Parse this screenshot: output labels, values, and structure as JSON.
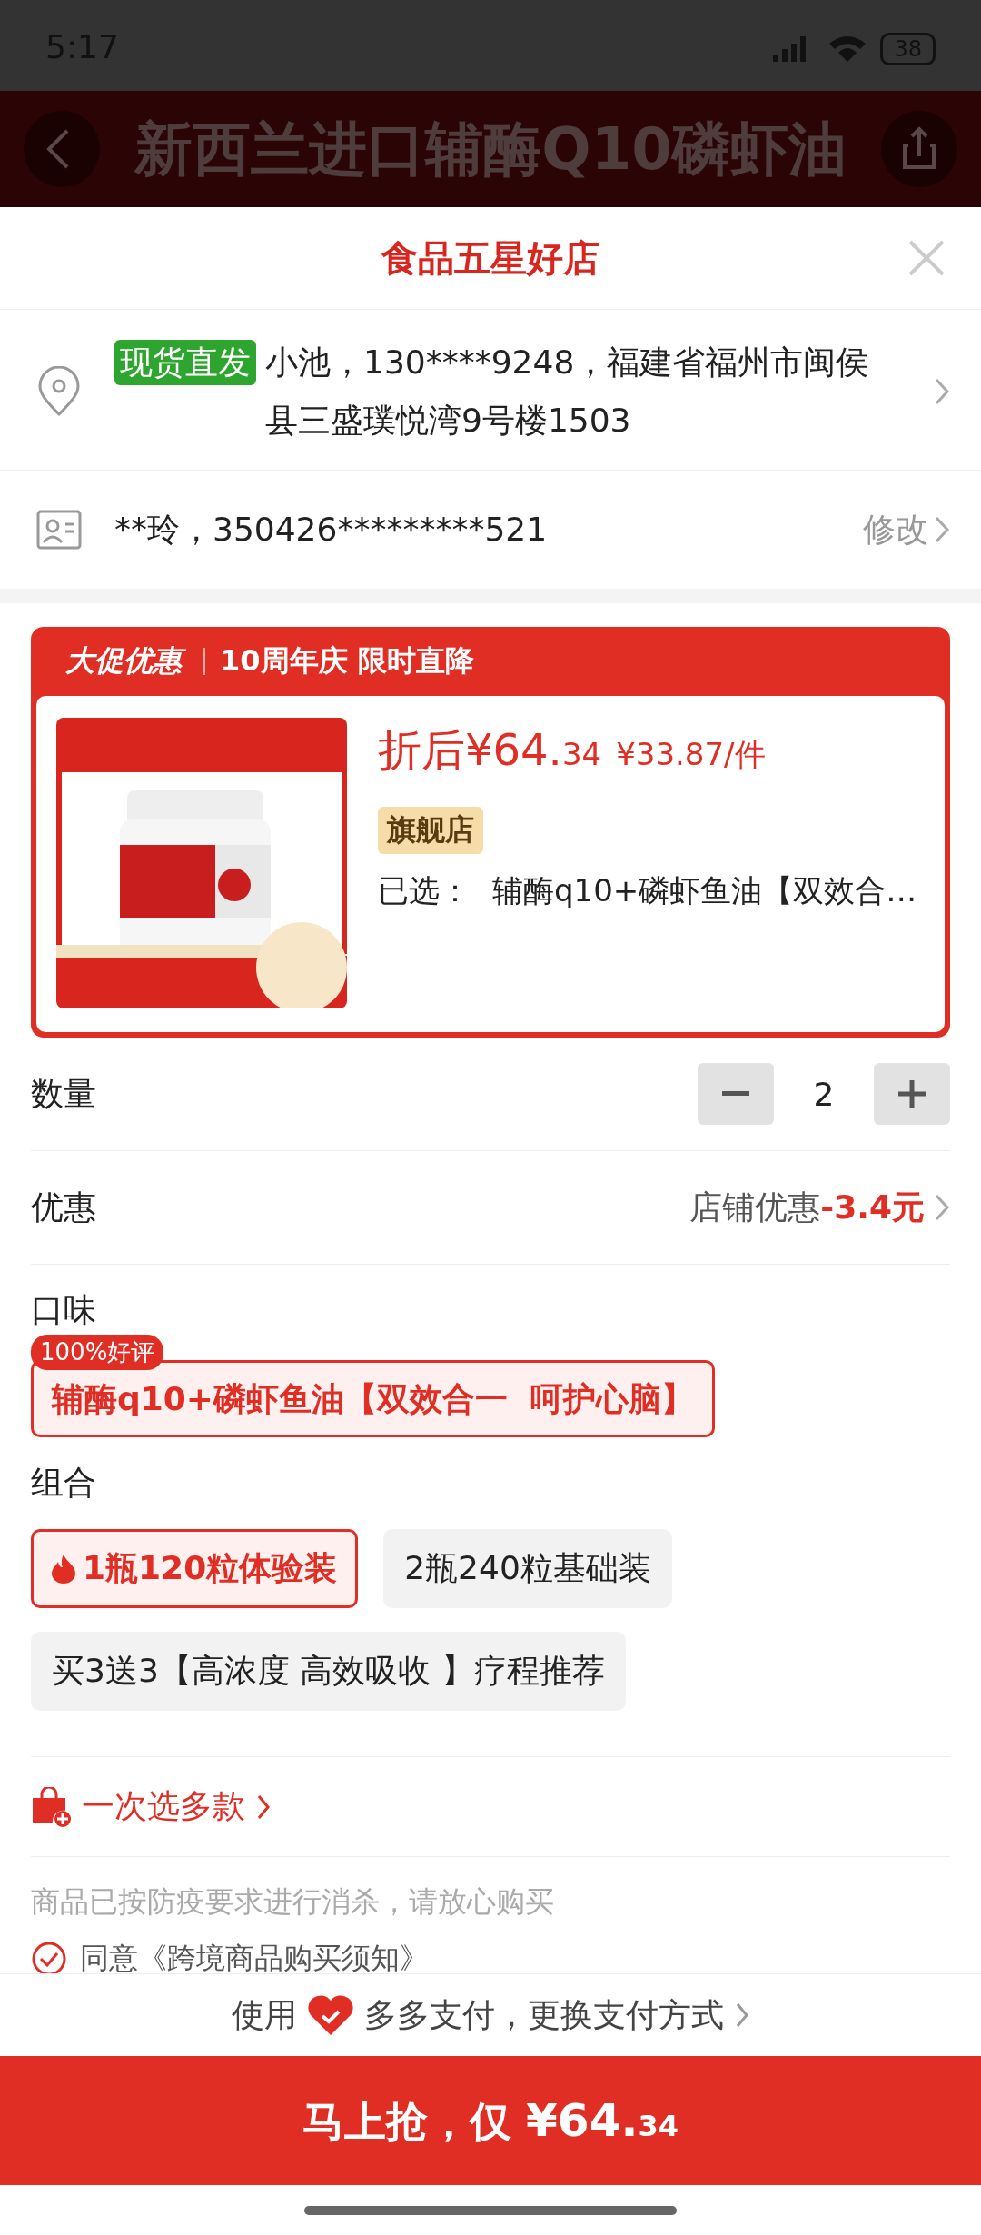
{
  "status_bar": {
    "time": "5:17",
    "battery": "38"
  },
  "header": {
    "title": "新西兰进口辅酶Q10磷虾油"
  },
  "sheet": {
    "title": "食品五星好店"
  },
  "address": {
    "tag": "现货直发",
    "text": "小池，130****9248，福建省福州市闽侯县三盛璞悦湾9号楼1503"
  },
  "identity": {
    "text": "**玲，350426*********521",
    "action": "修改"
  },
  "promo": {
    "label": "大促优惠",
    "subtitle": "10周年庆 限时直降",
    "price_prefix": "折后",
    "price": "¥64.",
    "price_decimal": "34",
    "unit_price": "¥33.87/件",
    "store_tag": "旗舰店",
    "selected_label": "已选：",
    "selected_value": "辅酶q10+磷虾鱼油【双效合…"
  },
  "quantity": {
    "label": "数量",
    "value": "2"
  },
  "discount": {
    "label": "优惠",
    "text": "店铺优惠",
    "amount": "-3.4元"
  },
  "flavor": {
    "label": "口味",
    "options": [
      {
        "label": "辅酶q10+磷虾鱼油【双效合一  呵护心脑】",
        "badge": "100%好评",
        "selected": true
      }
    ]
  },
  "combo": {
    "label": "组合",
    "options": [
      {
        "label": "1瓶120粒体验装",
        "hot": true,
        "selected": true
      },
      {
        "label": "2瓶240粒基础装",
        "hot": false,
        "selected": false
      },
      {
        "label": "买3送3【高浓度 高效吸收 】疗程推荐",
        "hot": false,
        "selected": false
      }
    ]
  },
  "multi": {
    "label": "一次选多款"
  },
  "notice": "商品已按防疫要求进行消杀，请放心购买",
  "agreement": {
    "text": "同意《跨境商品购买须知》",
    "checked": true
  },
  "payment": {
    "prefix": "使用",
    "method": "多多支付，更换支付方式"
  },
  "buy_button": {
    "label": "马上抢，仅 ",
    "price": "¥64.",
    "decimal": "34"
  }
}
